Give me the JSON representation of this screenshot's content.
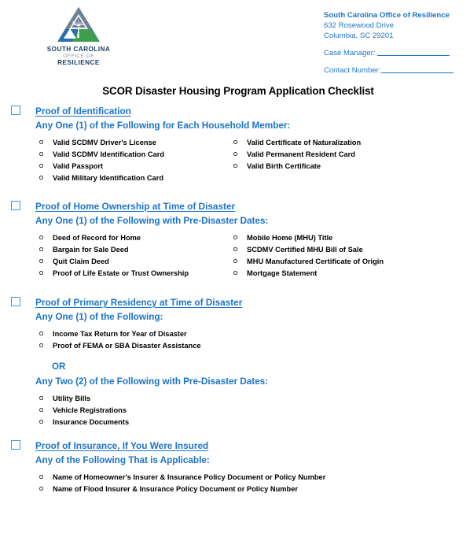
{
  "header": {
    "logo": {
      "name": "scor-logo",
      "line1": "SOUTH CAROLINA",
      "line2": "OFFICE OF",
      "line3": "RESILIENCE",
      "colors": {
        "navy": "#1c3f63",
        "gray_blue": "#7d98ad",
        "peak_gray": "#6d8296",
        "wedge_blue": "#2a6fa8",
        "wedge_green": "#3f9e4d"
      }
    },
    "agency": {
      "name": "South Carolina Office of Resilience",
      "street": "632 Rosewood Drive",
      "city_state_zip": "Columbia, SC 29201"
    },
    "fields": [
      {
        "label": "Case Manager:",
        "value": ""
      },
      {
        "label": "Contact Number:",
        "value": ""
      }
    ]
  },
  "title": "SCOR Disaster Housing Program Application Checklist",
  "accent_color": "#1d74c8",
  "checkbox_color": "#4a90e2",
  "sections": [
    {
      "id": "proof-of-identification",
      "checked": false,
      "title": "Proof of Identification",
      "subtitle": "Any One (1) of the Following for Each Household Member:",
      "column_left": [
        "Valid SCDMV Driver's License",
        "Valid SCDMV Identification Card",
        "Valid Passport",
        "Valid Military Identification Card"
      ],
      "column_right": [
        "Valid Certificate of Naturalization",
        "Valid Permanent Resident Card",
        "Valid Birth Certificate"
      ]
    },
    {
      "id": "proof-of-home-ownership",
      "checked": false,
      "title": "Proof of Home Ownership at Time of Disaster",
      "subtitle": "Any One (1) of the Following with Pre-Disaster Dates:",
      "column_left": [
        "Deed of Record for Home",
        "Bargain for Sale Deed",
        "Quit Claim Deed",
        "Proof of Life Estate or Trust Ownership"
      ],
      "column_right": [
        "Mobile Home (MHU) Title",
        "SCDMV Certified MHU Bill of Sale",
        "MHU Manufactured Certificate of Origin",
        "Mortgage Statement"
      ]
    },
    {
      "id": "proof-of-primary-residency",
      "checked": false,
      "title": "Proof of Primary Residency at Time of Disaster",
      "subtitle": "Any One (1) of the Following:",
      "column_left": [
        "Income Tax Return for Year of Disaster",
        "Proof of FEMA or SBA Disaster Assistance"
      ],
      "column_right": [],
      "or_label": "OR",
      "subtitle2": "Any Two (2) of the Following with Pre-Disaster Dates:",
      "column_left2": [
        "Utility Bills",
        "Vehicle Registrations",
        "Insurance Documents"
      ]
    },
    {
      "id": "proof-of-insurance",
      "checked": false,
      "title": "Proof of Insurance, If You Were Insured",
      "subtitle": "Any of the Following That is Applicable:",
      "column_left": [
        "Name of Homeowner's Insurer & Insurance Policy Document or Policy Number",
        "Name of Flood Insurer & Insurance Policy Document or Policy Number"
      ],
      "column_right": []
    }
  ]
}
